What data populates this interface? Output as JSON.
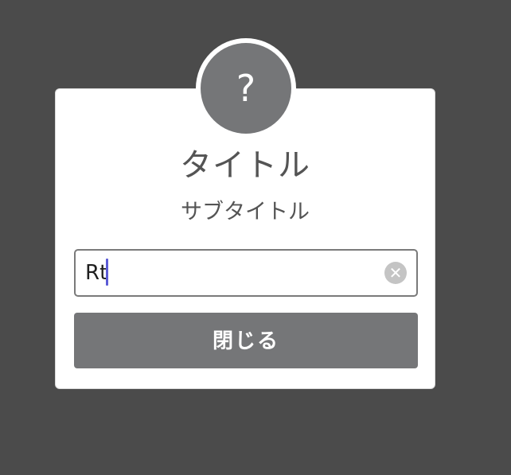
{
  "dialog": {
    "icon_glyph": "?",
    "icon_name": "question-icon",
    "title": "タイトル",
    "subtitle": "サブタイトル",
    "input": {
      "value": "Rt",
      "placeholder": ""
    },
    "clear_icon_glyph": "✕",
    "close_label": "閉じる"
  },
  "colors": {
    "backdrop": "#4b4b4b",
    "icon_bg": "#757678",
    "button_bg": "#757678",
    "caret": "#5b5bd6"
  }
}
